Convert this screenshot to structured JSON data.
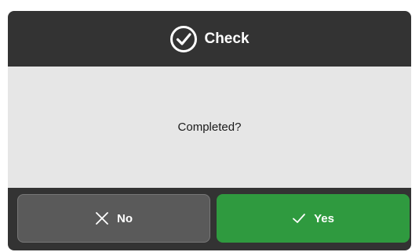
{
  "dialog": {
    "title": "Check",
    "title_icon": "check-circle-icon",
    "message": "Completed?",
    "colors": {
      "header_bg": "#333333",
      "body_bg": "#e6e6e6",
      "no_button_bg": "#5a5a5a",
      "yes_button_bg": "#2f9a3f"
    }
  },
  "actions": {
    "no_label": "No",
    "no_icon": "close-icon",
    "yes_label": "Yes",
    "yes_icon": "check-icon"
  }
}
